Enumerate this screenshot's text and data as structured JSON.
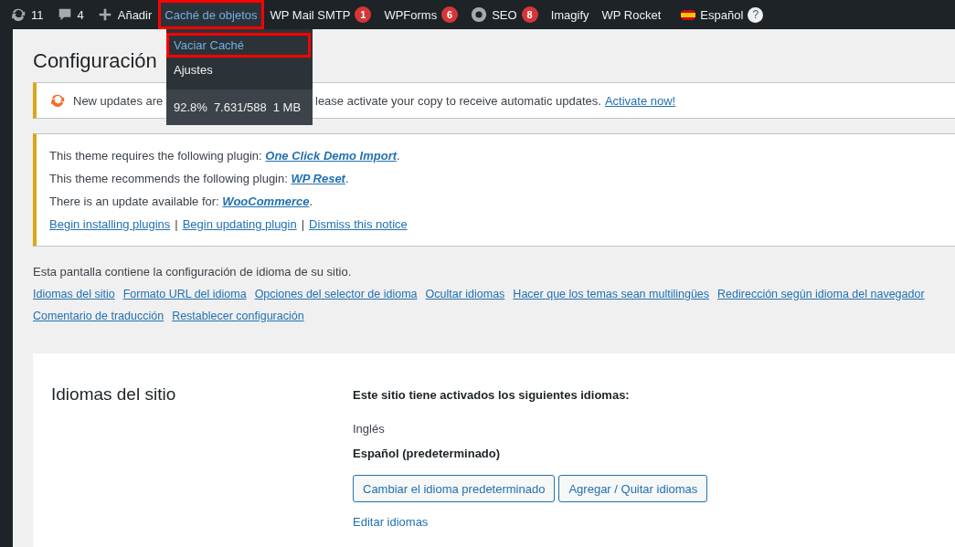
{
  "admin_bar": {
    "items": [
      {
        "kind": "updates",
        "label": "11",
        "selected": false,
        "highlighted": false
      },
      {
        "kind": "comments",
        "label": "4",
        "selected": false,
        "highlighted": false
      },
      {
        "kind": "add",
        "label": "Añadir",
        "selected": false,
        "highlighted": false
      },
      {
        "kind": "text",
        "label": "Caché de objetos",
        "selected": true,
        "highlighted": true
      },
      {
        "kind": "text",
        "label": "WP Mail SMTP",
        "badge": "1",
        "selected": false,
        "highlighted": false
      },
      {
        "kind": "text",
        "label": "WPForms",
        "badge": "6",
        "selected": false,
        "highlighted": false
      },
      {
        "kind": "seo",
        "label": "SEO",
        "badge": "8",
        "selected": false,
        "highlighted": false
      },
      {
        "kind": "text",
        "label": "Imagify",
        "selected": false,
        "highlighted": false
      },
      {
        "kind": "text",
        "label": "WP Rocket",
        "selected": false,
        "highlighted": false
      },
      {
        "kind": "language",
        "label": "Español",
        "help": "?",
        "selected": false,
        "highlighted": false
      }
    ]
  },
  "dropdown": {
    "items": [
      {
        "label": "Vaciar Caché",
        "highlighted": true
      },
      {
        "label": "Ajustes",
        "highlighted": false
      }
    ],
    "stats": [
      "92.8%",
      "7.631/588",
      "1 MB"
    ]
  },
  "page_title": "Configuración",
  "update_notice": {
    "text_before": "New updates are",
    "text_after": "lease activate your copy to receive automatic updates.",
    "link": "Activate now!"
  },
  "plugin_notice": {
    "lines": [
      {
        "text": "This theme requires the following plugin:",
        "link": "One Click Demo Import",
        "suffix": "."
      },
      {
        "text": "This theme recommends the following plugin:",
        "link": "WP Reset",
        "suffix": "."
      },
      {
        "text": "There is an update available for:",
        "link": "WooCommerce",
        "suffix": "."
      }
    ],
    "actions": [
      "Begin installing plugins",
      "Begin updating plugin",
      "Dismiss this notice"
    ],
    "separator": "|"
  },
  "description": "Esta pantalla contiene la configuración de idioma de su sitio.",
  "section_links": [
    "Idiomas del sitio",
    "Formato URL del idioma",
    "Opciones del selector de idioma",
    "Ocultar idiomas",
    "Hacer que los temas sean multilingües",
    "Redirección según idioma del navegador",
    "Comentario de traducción",
    "Restablecer configuración"
  ],
  "site_languages": {
    "heading": "Idiomas del sitio",
    "intro": "Este sitio tiene activados los siguientes idiomas:",
    "languages": [
      {
        "name": "Inglés",
        "default": false
      },
      {
        "name": "Español (predeterminado)",
        "default": true
      }
    ],
    "buttons": [
      "Cambiar el idioma predeterminado",
      "Agregar / Quitar idiomas"
    ],
    "edit_link": "Editar idiomas"
  }
}
